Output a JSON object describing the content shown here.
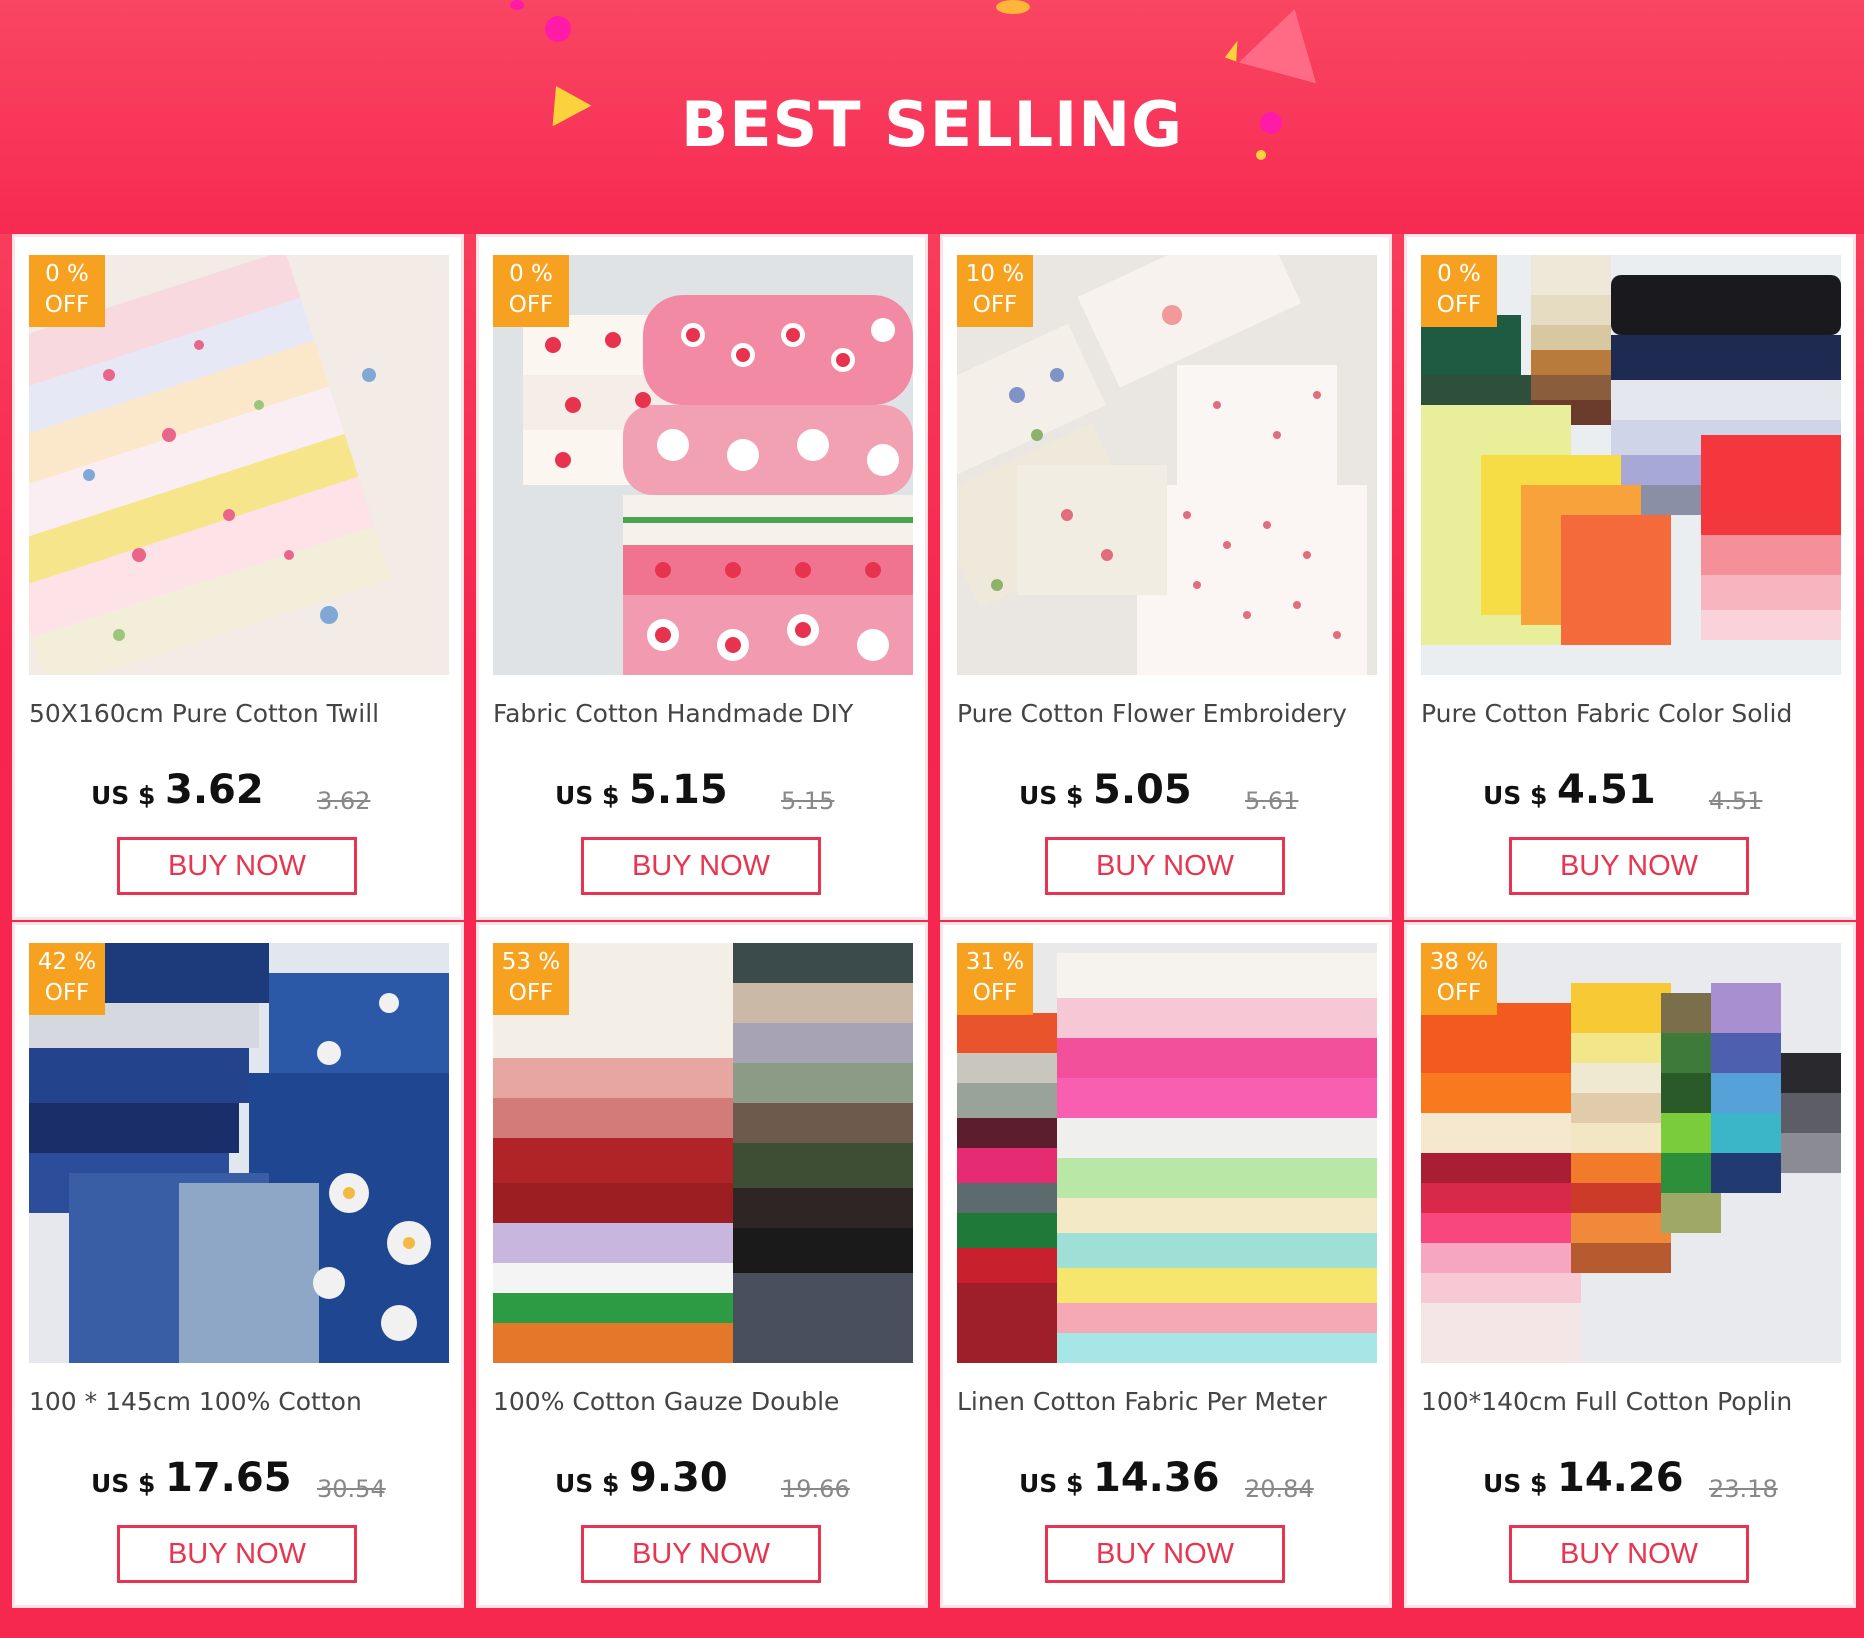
{
  "banner": {
    "title": "BEST SELLING",
    "colors": {
      "background": "#f7254d",
      "confetti_magenta": "#ff1aa8",
      "confetti_yellow": "#f9d23c"
    }
  },
  "products": [
    {
      "badge_pct": "0  %",
      "badge_off": "OFF",
      "title": "50X160cm Pure Cotton Twill",
      "currency": "US $",
      "price": "3.62",
      "old_price": "3.62",
      "buy": "BUY NOW",
      "image": "floral-cotton-twill-image"
    },
    {
      "badge_pct": "0  %",
      "badge_off": "OFF",
      "title": "Fabric Cotton Handmade DIY",
      "currency": "US $",
      "price": "5.15",
      "old_price": "5.15",
      "buy": "BUY NOW",
      "image": "strawberry-fabric-image"
    },
    {
      "badge_pct": "10  %",
      "badge_off": "OFF",
      "title": "Pure Cotton Flower Embroidery",
      "currency": "US $",
      "price": "5.05",
      "old_price": "5.61",
      "buy": "BUY NOW",
      "image": "flower-embroidery-image"
    },
    {
      "badge_pct": "0  %",
      "badge_off": "OFF",
      "title": "Pure Cotton Fabric Color Solid",
      "currency": "US $",
      "price": "4.51",
      "old_price": "4.51",
      "buy": "BUY NOW",
      "image": "solid-color-fabric-image"
    },
    {
      "badge_pct": "42  %",
      "badge_off": "OFF",
      "title": "100 * 145cm 100% Cotton",
      "currency": "US $",
      "price": "17.65",
      "old_price": "30.54",
      "buy": "BUY NOW",
      "image": "blue-print-fabric-image"
    },
    {
      "badge_pct": "53  %",
      "badge_off": "OFF",
      "title": "100% Cotton Gauze Double",
      "currency": "US $",
      "price": "9.30",
      "old_price": "19.66",
      "buy": "BUY NOW",
      "image": "gauze-fabric-image"
    },
    {
      "badge_pct": "31  %",
      "badge_off": "OFF",
      "title": "Linen Cotton Fabric Per Meter",
      "currency": "US $",
      "price": "14.36",
      "old_price": "20.84",
      "buy": "BUY NOW",
      "image": "linen-cotton-fabric-image"
    },
    {
      "badge_pct": "38  %",
      "badge_off": "OFF",
      "title": "100*140cm Full Cotton Poplin",
      "currency": "US $",
      "price": "14.26",
      "old_price": "23.18",
      "buy": "BUY NOW",
      "image": "poplin-fabric-image"
    }
  ]
}
